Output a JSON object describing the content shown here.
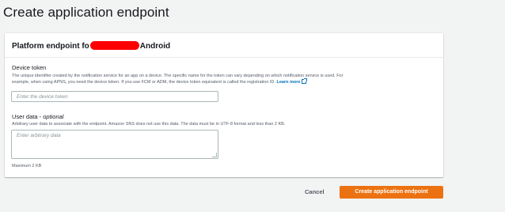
{
  "page": {
    "title": "Create application endpoint"
  },
  "panel": {
    "title_prefix": "Platform endpoint fo",
    "title_suffix": "Android"
  },
  "device_token": {
    "label": "Device token",
    "description_1": "The unique identifier created by the notification service for an app on a device. The specific name for the token can vary depending on which notification service is used. For",
    "description_2": "example, when using APNS, you need the device token. If you use FCM or ADM, the device token equivalent is called the registration ID.",
    "learn_more": "Learn more",
    "placeholder": "Enter the device token",
    "value": ""
  },
  "user_data": {
    "label": "User data - ",
    "label_optional": "optional",
    "description": "Arbitrary user data to associate with the endpoint. Amazon SNS does not use this data. The data must be in UTF-8 format and less than 2 KB.",
    "placeholder": "Enter arbitrary data",
    "constraint": "Maximum 2 KB"
  },
  "footer": {
    "cancel_label": "Cancel",
    "primary_label": "Create application endpoint"
  },
  "colors": {
    "primary": "#ec7211",
    "link": "#0073bb",
    "redaction": "#ff0000"
  },
  "icons": {
    "external_link": "external-link-icon"
  }
}
